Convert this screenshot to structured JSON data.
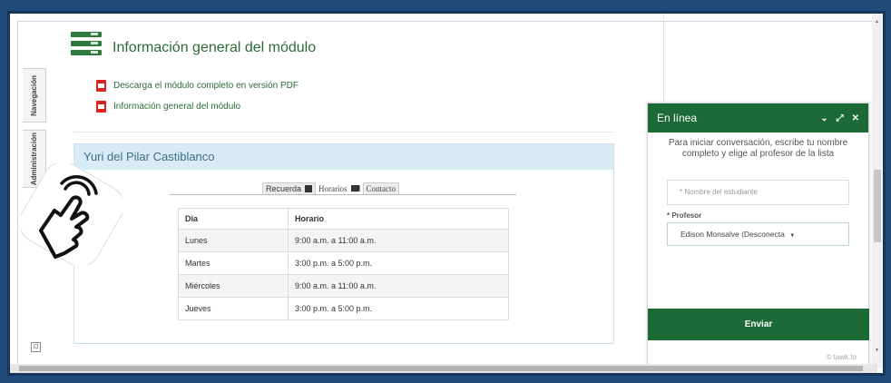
{
  "sidebar": {
    "tabs": [
      "Navegación",
      "Administración"
    ],
    "toggle_glyph": "⊡"
  },
  "header": {
    "title": "Información general del módulo",
    "icon": "menu-bars-icon"
  },
  "links": [
    {
      "label": "Descarga el módulo completo en versión PDF",
      "icon": "pdf-icon"
    },
    {
      "label": "Información general del módulo",
      "icon": "pdf-icon"
    }
  ],
  "teacher": {
    "name": "Yuri del Pilar Castiblanco",
    "tabs": [
      {
        "label": "Recuerda",
        "icon": "calendar-icon"
      },
      {
        "label": "Horarios",
        "icon": "mail-icon"
      },
      {
        "label": "Contacto"
      }
    ],
    "table": {
      "headers": [
        "Dia",
        "Horario"
      ],
      "rows": [
        [
          "Lunes",
          "9:00 a.m. a 11:00 a.m."
        ],
        [
          "Martes",
          "3:00 p.m. a 5:00 p.m."
        ],
        [
          "Miércoles",
          "9:00 a.m. a 11:00 a.m."
        ],
        [
          "Jueves",
          "3:00 p.m. a 5:00 p.m."
        ]
      ]
    }
  },
  "chat": {
    "title": "En línea",
    "controls": [
      "⌄",
      "⤢",
      "✕"
    ],
    "intro": "Para iniciar conversación, escribe tu nombre completo y elige al profesor de la lista",
    "name_placeholder": "* Nombre del estudiante",
    "profesor_label": "* Profesor",
    "profesor_value": "Edison Monsalve (Desconecta",
    "select_caret": "▼",
    "send_label": "Enviar",
    "brand": "© tawk.to"
  },
  "colors": {
    "brand_green": "#1c6a35",
    "frame_blue": "#1f4a7a",
    "pdf_red": "#d9241f"
  }
}
